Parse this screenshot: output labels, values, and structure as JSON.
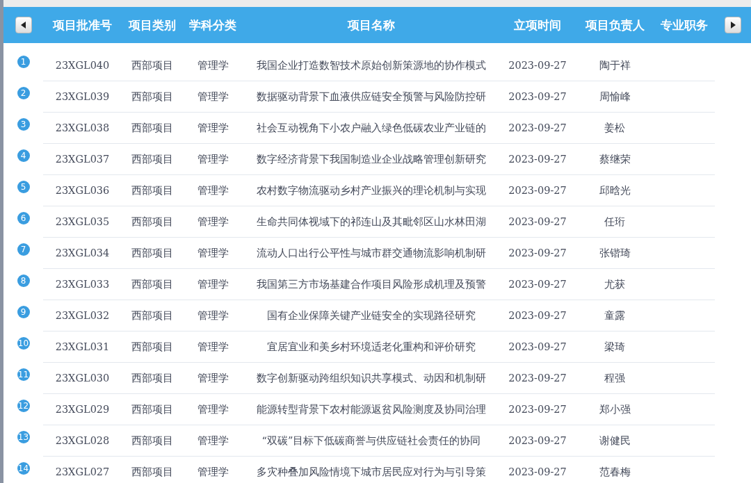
{
  "table": {
    "columns": [
      "项目批准号",
      "项目类别",
      "学科分类",
      "项目名称",
      "立项时间",
      "项目负责人",
      "专业职务"
    ],
    "rows": [
      {
        "index": "1",
        "id": "23XGL040",
        "type": "西部项目",
        "subject": "管理学",
        "name": "我国企业打造数智技术原始创新策源地的协作模式",
        "date": "2023-09-27",
        "leader": "陶于祥"
      },
      {
        "index": "2",
        "id": "23XGL039",
        "type": "西部项目",
        "subject": "管理学",
        "name": "数据驱动背景下血液供应链安全预警与风险防控研",
        "date": "2023-09-27",
        "leader": "周愉峰"
      },
      {
        "index": "3",
        "id": "23XGL038",
        "type": "西部项目",
        "subject": "管理学",
        "name": "社会互动视角下小农户融入绿色低碳农业产业链的",
        "date": "2023-09-27",
        "leader": "姜松"
      },
      {
        "index": "4",
        "id": "23XGL037",
        "type": "西部项目",
        "subject": "管理学",
        "name": "数字经济背景下我国制造业企业战略管理创新研究",
        "date": "2023-09-27",
        "leader": "蔡继荣"
      },
      {
        "index": "5",
        "id": "23XGL036",
        "type": "西部项目",
        "subject": "管理学",
        "name": "农村数字物流驱动乡村产业振兴的理论机制与实现",
        "date": "2023-09-27",
        "leader": "邱晗光"
      },
      {
        "index": "6",
        "id": "23XGL035",
        "type": "西部项目",
        "subject": "管理学",
        "name": "生命共同体视域下的祁连山及其毗邻区山水林田湖",
        "date": "2023-09-27",
        "leader": "任珩"
      },
      {
        "index": "7",
        "id": "23XGL034",
        "type": "西部项目",
        "subject": "管理学",
        "name": "流动人口出行公平性与城市群交通物流影响机制研",
        "date": "2023-09-27",
        "leader": "张锴琦"
      },
      {
        "index": "8",
        "id": "23XGL033",
        "type": "西部项目",
        "subject": "管理学",
        "name": "我国第三方市场基建合作项目风险形成机理及预警",
        "date": "2023-09-27",
        "leader": "尤获"
      },
      {
        "index": "9",
        "id": "23XGL032",
        "type": "西部项目",
        "subject": "管理学",
        "name": "国有企业保障关键产业链安全的实现路径研究",
        "date": "2023-09-27",
        "leader": "童露"
      },
      {
        "index": "10",
        "id": "23XGL031",
        "type": "西部项目",
        "subject": "管理学",
        "name": "宜居宜业和美乡村环境适老化重构和评价研究",
        "date": "2023-09-27",
        "leader": "梁琦"
      },
      {
        "index": "11",
        "id": "23XGL030",
        "type": "西部项目",
        "subject": "管理学",
        "name": "数字创新驱动跨组织知识共享模式、动因和机制研",
        "date": "2023-09-27",
        "leader": "程强"
      },
      {
        "index": "12",
        "id": "23XGL029",
        "type": "西部项目",
        "subject": "管理学",
        "name": "能源转型背景下农村能源返贫风险测度及协同治理",
        "date": "2023-09-27",
        "leader": "郑小强"
      },
      {
        "index": "13",
        "id": "23XGL028",
        "type": "西部项目",
        "subject": "管理学",
        "name": "“双碳”目标下低碳商誉与供应链社会责任的协同",
        "date": "2023-09-27",
        "leader": "谢健民"
      },
      {
        "index": "14",
        "id": "23XGL027",
        "type": "西部项目",
        "subject": "管理学",
        "name": "多灾种叠加风险情境下城市居民应对行为与引导策",
        "date": "2023-09-27",
        "leader": "范春梅"
      }
    ]
  }
}
